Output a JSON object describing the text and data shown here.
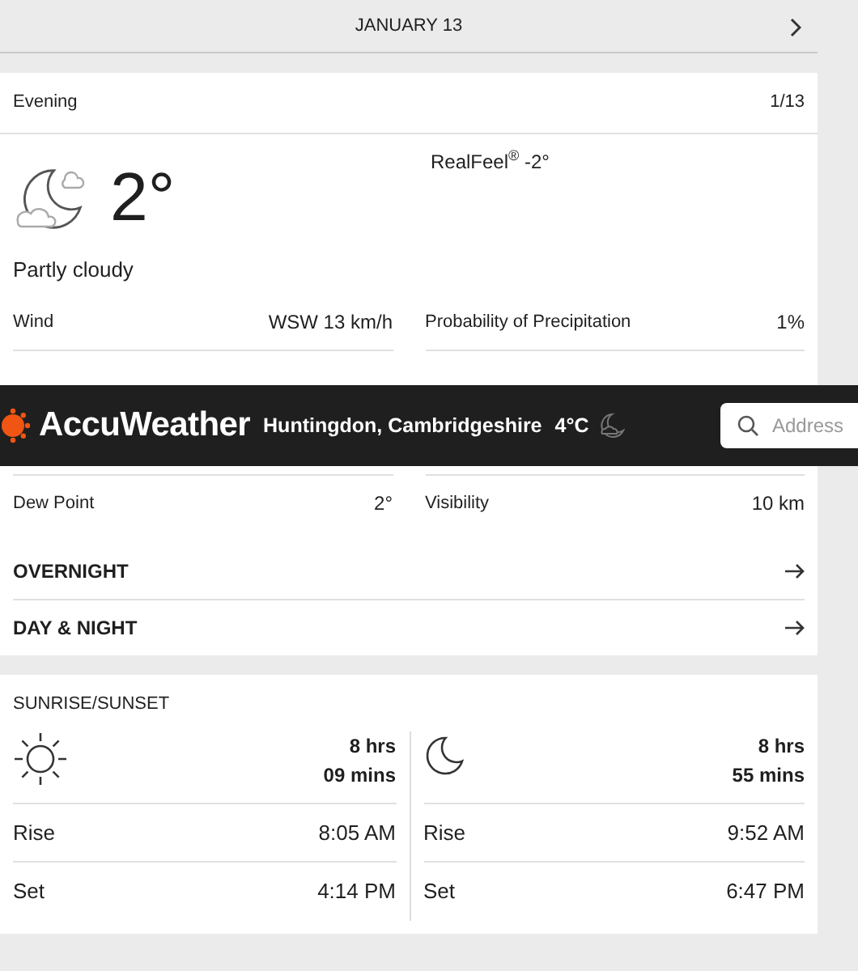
{
  "date_bar": {
    "title": "JANUARY 13"
  },
  "forecast": {
    "period": "Evening",
    "page": "1/13",
    "temperature": "2°",
    "realfeel": "RealFeel$^{®}$ -2°",
    "condition": "Partly cloudy",
    "details": [
      [
        {
          "label": "Wind",
          "value": "WSW 13 km/h"
        },
        {
          "label": "Probability of Precipitation",
          "value": "1%"
        }
      ],
      [
        {
          "label": "Dew Point",
          "value": "2°"
        },
        {
          "label": "Visibility",
          "value": "10 km"
        }
      ]
    ],
    "links": [
      {
        "label": "OVERNIGHT"
      },
      {
        "label": "DAY & NIGHT"
      }
    ]
  },
  "sticky_header": {
    "brand": "AccuWeather",
    "location": "Huntingdon, Cambridgeshire",
    "temperature": "4°C",
    "search": {
      "placeholder": "Address"
    }
  },
  "sun_moon": {
    "title": "SUNRISE/SUNSET",
    "bodies": [
      {
        "kind": "sun",
        "hours": "8 hrs",
        "minutes": "09 mins",
        "times": [
          {
            "label": "Rise",
            "value": "8:05 AM"
          },
          {
            "label": "Set",
            "value": "4:14 PM"
          }
        ]
      },
      {
        "kind": "moon",
        "hours": "8 hrs",
        "minutes": "55 mins",
        "times": [
          {
            "label": "Rise",
            "value": "9:52 AM"
          },
          {
            "label": "Set",
            "value": "6:47 PM"
          }
        ]
      }
    ]
  }
}
